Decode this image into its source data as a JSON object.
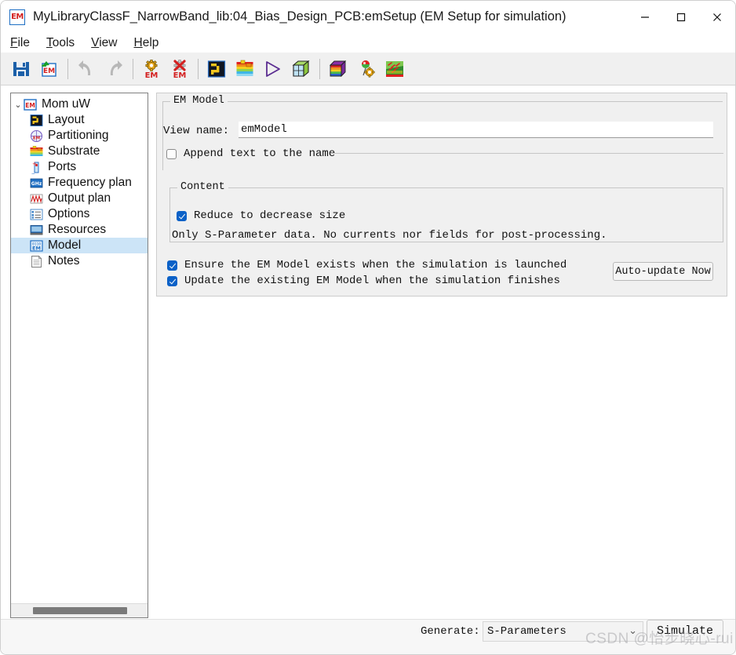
{
  "window": {
    "title": "MyLibraryClassF_NarrowBand_lib:04_Bias_Design_PCB:emSetup (EM Setup for simulation)",
    "app_icon_text": "EM",
    "controls": {
      "minimize": "—",
      "maximize": "☐",
      "close": "✕"
    }
  },
  "menubar": {
    "items": [
      {
        "accel": "F",
        "rest": "ile"
      },
      {
        "accel": "T",
        "rest": "ools"
      },
      {
        "accel": "V",
        "rest": "iew"
      },
      {
        "accel": "H",
        "rest": "elp"
      }
    ]
  },
  "toolbar": {
    "buttons": [
      {
        "name": "save-icon",
        "title": "Save"
      },
      {
        "name": "save-em-setup-icon",
        "title": "Save EM Setup"
      },
      {
        "name": "undo-icon",
        "title": "Undo"
      },
      {
        "name": "redo-icon",
        "title": "Redo"
      },
      {
        "name": "em-settings-icon",
        "title": "EM Settings"
      },
      {
        "name": "em-delete-icon",
        "title": "Delete EM Setup"
      },
      {
        "name": "layout-icon",
        "title": "Layout"
      },
      {
        "name": "substrate-icon",
        "title": "Substrate"
      },
      {
        "name": "simulate-play-icon",
        "title": "Simulate"
      },
      {
        "name": "3d-view-icon",
        "title": "3D View"
      },
      {
        "name": "rainbow-cube-icon",
        "title": "EM Cockpit"
      },
      {
        "name": "mesh-settings-icon",
        "title": "Mesh Settings"
      },
      {
        "name": "em-visualization-icon",
        "title": "EM Visualization"
      }
    ]
  },
  "sidebar": {
    "root": {
      "label": "Mom uW",
      "icon": "em-icon",
      "expanded": true,
      "twisty": "⌄"
    },
    "items": [
      {
        "label": "Layout",
        "icon": "layout-icon",
        "selected": false
      },
      {
        "label": "Partitioning",
        "icon": "partitioning-icon",
        "selected": false
      },
      {
        "label": "Substrate",
        "icon": "substrate-icon",
        "selected": false
      },
      {
        "label": "Ports",
        "icon": "ports-icon",
        "selected": false
      },
      {
        "label": "Frequency plan",
        "icon": "ghz-icon",
        "selected": false
      },
      {
        "label": "Output plan",
        "icon": "output-plan-icon",
        "selected": false
      },
      {
        "label": "Options",
        "icon": "options-icon",
        "selected": false
      },
      {
        "label": "Resources",
        "icon": "resources-icon",
        "selected": false
      },
      {
        "label": "Model",
        "icon": "model-em-icon",
        "selected": true
      },
      {
        "label": "Notes",
        "icon": "notes-icon",
        "selected": false
      }
    ]
  },
  "main": {
    "em_model_group": {
      "title": "EM Model",
      "view_name_label": "View name:",
      "view_name_value": "emModel",
      "view_name_placeholder": "emModel",
      "append_checkbox": {
        "label": "Append text to the name",
        "checked": false
      }
    },
    "content_group": {
      "title": "Content",
      "reduce_checkbox": {
        "label": "Reduce to decrease size",
        "checked": true
      },
      "description": "Only S-Parameter data. No currents nor fields for post-processing."
    },
    "ensure_checkbox": {
      "label": "Ensure the EM Model exists when the simulation is launched",
      "checked": true
    },
    "update_checkbox": {
      "label": "Update the existing EM Model when the simulation finishes",
      "checked": true
    },
    "auto_update_button": "Auto-update Now"
  },
  "bottombar": {
    "generate_label": "Generate:",
    "generate_value": "S-Parameters",
    "generate_chevron": "⌄",
    "simulate_button": "Simulate"
  },
  "watermark": "CSDN @怡步晓心-rui",
  "colors": {
    "accent_checkbox": "#0b61c7",
    "selection": "#cce4f7",
    "panel_bg": "#f0f0f0",
    "toolbar_bg": "#f0f0f0"
  }
}
